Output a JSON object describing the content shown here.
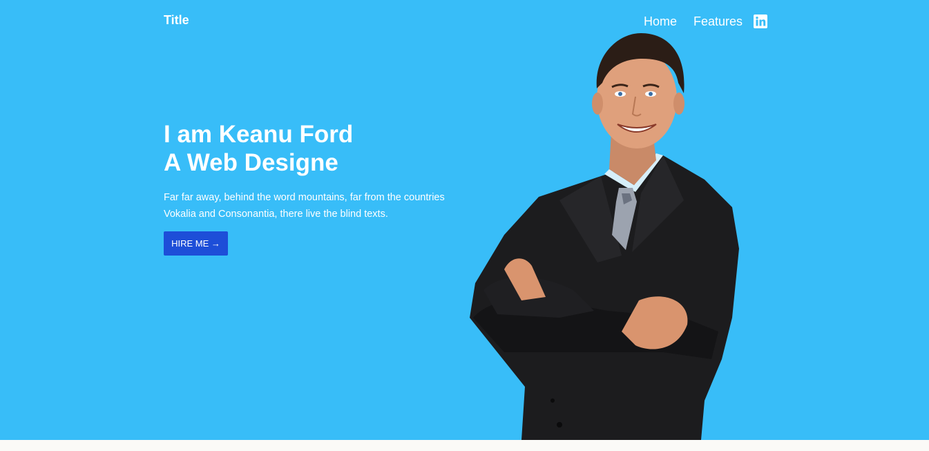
{
  "nav": {
    "brand": "Title",
    "links": [
      "Home",
      "Features"
    ],
    "social_icon": "linkedin-icon"
  },
  "hero": {
    "headline_line1": "I am Keanu Ford",
    "headline_line2": "A Web Designe",
    "description_line1": "Far far away, behind the word mountains, far from the countries",
    "description_line2": "Vokalia and Consonantia, there live the blind texts.",
    "cta_label": "HIRE ME →",
    "image": "businessman-portrait"
  },
  "colors": {
    "hero_bg": "#38bdf8",
    "button_bg": "#1d4ed8",
    "text": "#ffffff",
    "page_bg": "#fbfaf7"
  }
}
